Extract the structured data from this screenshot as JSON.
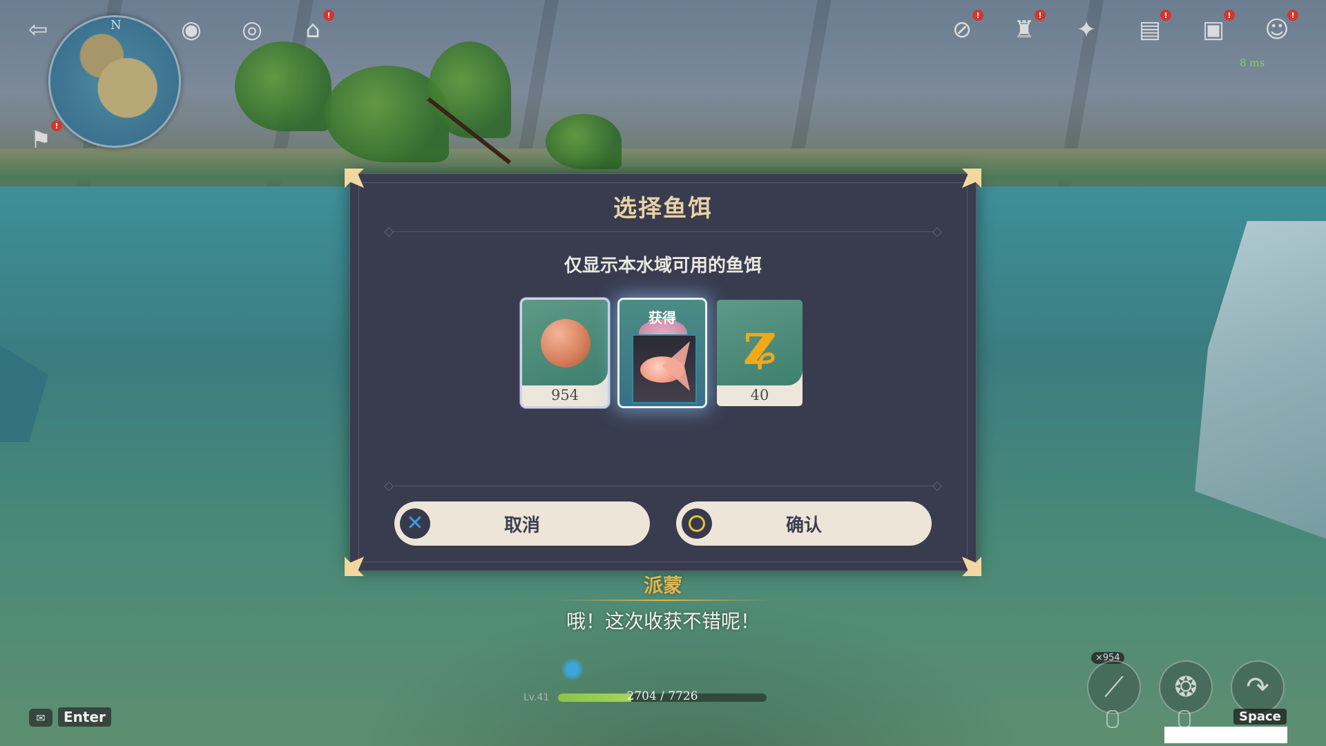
{
  "hud": {
    "minimap_north": "N",
    "ping": "8 ms",
    "badge": "!"
  },
  "dialog": {
    "title": "选择鱼饵",
    "subtitle": "仅显示本水域可用的鱼饵",
    "baits": [
      {
        "name": "fruit-paste-bait",
        "count": "954",
        "selected": true
      },
      {
        "name": "obtain-bait",
        "label": "获得",
        "selected": false
      },
      {
        "name": "worm-bait",
        "count": "40",
        "selected": false
      }
    ],
    "cancel_label": "取消",
    "confirm_label": "确认",
    "colors": {
      "panel": "#393c4f",
      "title": "#e7d2a6",
      "button": "#ece5d8",
      "cancel_icon": "#3f9ae4",
      "confirm_icon": "#e8c531"
    }
  },
  "dialogue": {
    "speaker": "派蒙",
    "line": "哦！这次收获不错呢！"
  },
  "bottom": {
    "chat_key": "Enter",
    "level": "Lv.41",
    "xp_text": "2704 / 7726",
    "xp_fraction": 0.35,
    "rod_count": "×954",
    "jump_key": "Space"
  }
}
